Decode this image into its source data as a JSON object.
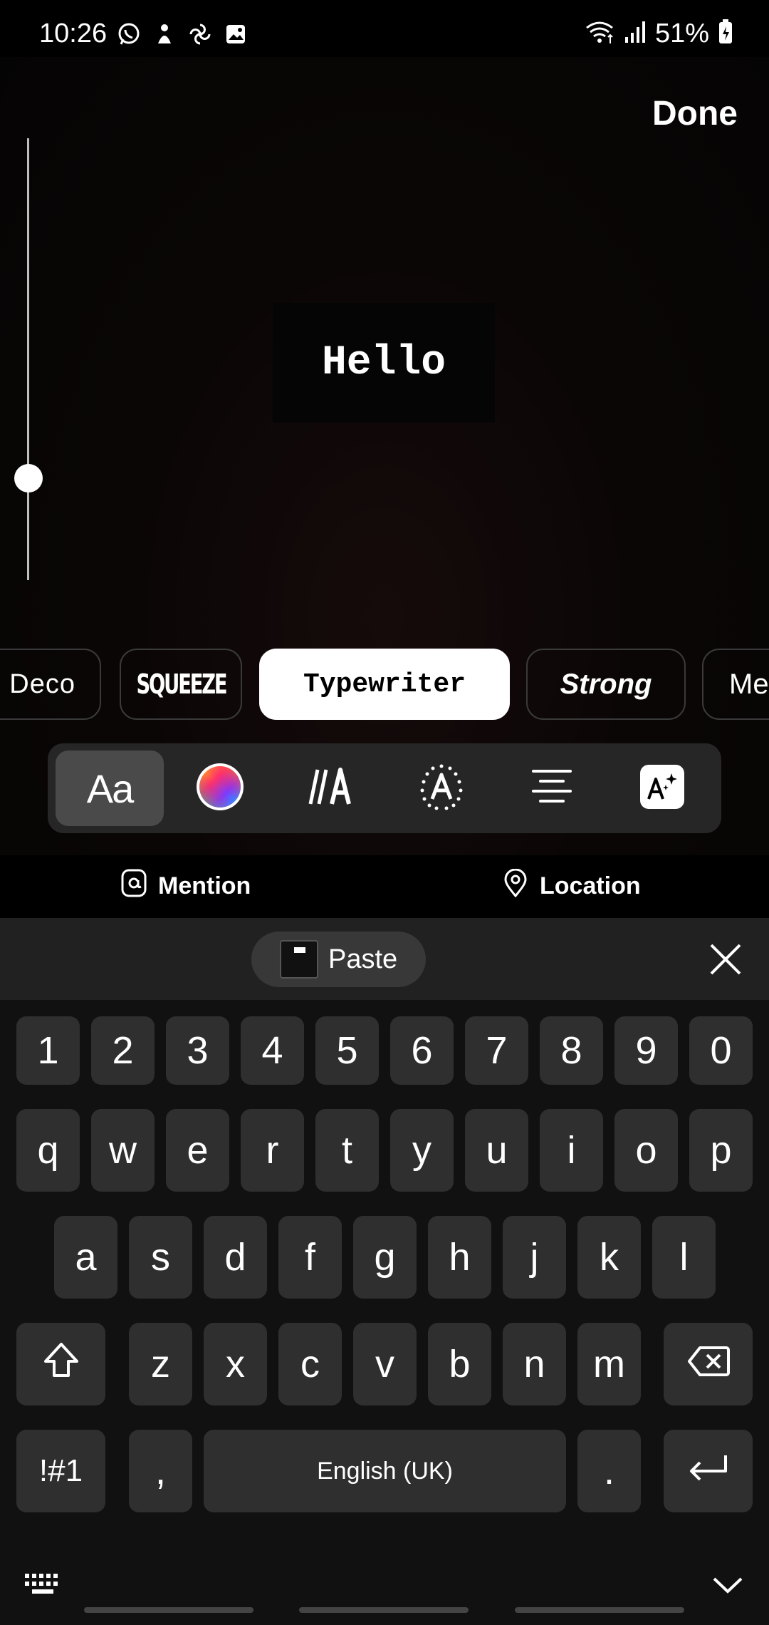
{
  "status_bar": {
    "time": "10:26",
    "battery": "51%",
    "notification_icons": [
      "whatsapp-icon",
      "figure-icon",
      "pinwheel-icon",
      "gallery-icon"
    ]
  },
  "editor": {
    "done_label": "Done",
    "text_content": "Hello",
    "size_level": 0.22
  },
  "fonts": {
    "items": [
      "Deco",
      "SQUEEZE",
      "Typewriter",
      "Strong",
      "Meme"
    ],
    "visible_labels": [
      "Deco",
      "SQUEEZE",
      "Typewriter",
      "Strong",
      "Mer"
    ],
    "selected": "Typewriter"
  },
  "tools": {
    "font_label": "Aa",
    "items": [
      "font-icon",
      "color-wheel-icon",
      "animate-text-icon",
      "text-effect-icon",
      "align-center-icon",
      "ai-text-icon"
    ]
  },
  "tags": {
    "mention_label": "Mention",
    "location_label": "Location"
  },
  "clipboard": {
    "paste_label": "Paste"
  },
  "keyboard": {
    "row_numbers": [
      "1",
      "2",
      "3",
      "4",
      "5",
      "6",
      "7",
      "8",
      "9",
      "0"
    ],
    "row_1": [
      "q",
      "w",
      "e",
      "r",
      "t",
      "y",
      "u",
      "i",
      "o",
      "p"
    ],
    "row_2": [
      "a",
      "s",
      "d",
      "f",
      "g",
      "h",
      "j",
      "k",
      "l"
    ],
    "row_3": [
      "z",
      "x",
      "c",
      "v",
      "b",
      "n",
      "m"
    ],
    "symbols_label": "!#1",
    "comma_label": ",",
    "space_label": "English (UK)",
    "period_label": "."
  },
  "colors": {
    "key_bg": "#2f2f2f",
    "keyboard_bg": "#111111",
    "chip_selected_bg": "#ffffff"
  }
}
